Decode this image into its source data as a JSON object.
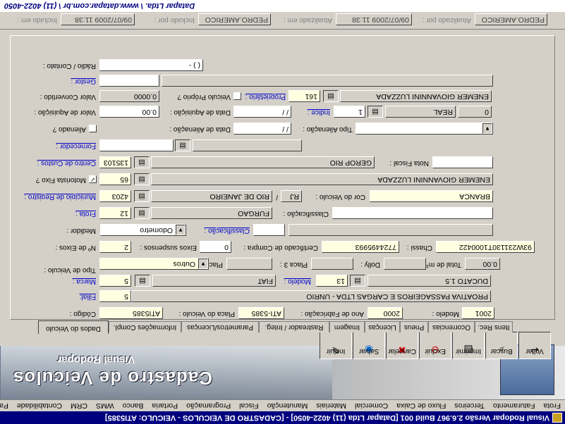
{
  "window": {
    "title": "Visual Rodopar Versão 2.6.967 Build 001 [Datapar Ltda (11) 4022-4050] - [CADASTRO DE VEICULOS - VEICULO: ATI5385]"
  },
  "menu": [
    "Frota",
    "Faturamento",
    "Terceiros",
    "Fluxo de Caixa",
    "Comercial",
    "Materiais",
    "Manutenção",
    "Fiscal",
    "Programação",
    "Portaria",
    "Banco",
    "WMS",
    "CRM",
    "Contabilidade",
    "Pa"
  ],
  "banner": {
    "title": "Cadastro de Veiculos",
    "brand": "Visual Rodopar"
  },
  "toolbar": [
    {
      "label": "Incluir",
      "icon": "✎"
    },
    {
      "label": "Salvar",
      "icon": "◉"
    },
    {
      "label": "Cancelar",
      "icon": "✖"
    },
    {
      "label": "Excluir",
      "icon": "⊖"
    },
    {
      "label": "Imprimir",
      "icon": "▤"
    },
    {
      "label": "Buscar",
      "icon": "⌕"
    },
    {
      "label": "Voltar",
      "icon": "↩"
    }
  ],
  "tabs": [
    "Dados do Veiculo",
    "Informações Compl.",
    "Parametros/Licenças",
    "Rastreador / Integ.",
    "Imagem",
    "Licenças",
    "Pneus",
    "Ocorrencias",
    "Itens Rec."
  ],
  "labels": {
    "codigo": "Código :",
    "placa": "Placa do Veiculo :",
    "ano_fab": "Ano de Fabricação :",
    "modelo_ano": "Modelo :",
    "filial": "Filial:",
    "marca": "Marca :",
    "modelo": "Modelo :",
    "tipo_veiculo": "Tipo de Veiculo :",
    "placa2": "Placa 2 :",
    "placa3": "Placa 3 :",
    "dolly": "Dolly :",
    "total_m3": "Total de m³ :",
    "nr_eixos": "Nº de Eixos :",
    "eixos_susp": "Eixos suspensos :",
    "certificado": "Certificado de Compra :",
    "chassi": "Chassi :",
    "medidor": "Medidor :",
    "classificacao": "Classificação :",
    "frota": "Frota :",
    "classificacao2": "Classificação :",
    "municipio": "Municipio de Registro :",
    "uf_sep": "/",
    "cor": "Cor do Veiculo :",
    "motorista": "Motorista Fixo ?",
    "centro_custos": "Centro de Custos :",
    "nota_fiscal": "Nota Fiscal :",
    "fornecedor": "Fornecedor :",
    "alienado": "Alienado ?",
    "data_alienacao": "Data de Alienação :",
    "tipo_alienacao": "Tipo Alienação :",
    "valor_aquisicao": "Valor de Aquisição :",
    "data_aquisicao": "Data de Aquisição :",
    "indice": "Indice :",
    "valor_convertido": "Valor Convertido :",
    "veiculo_proprio": "Veiculo Próprio ?",
    "proprietario": "Proprietário :",
    "gestor": "Gestor :",
    "radio": "Rádio / Contato :"
  },
  "values": {
    "codigo": "ATI5385",
    "placa": "ATI-5385",
    "ano_fab": "2000",
    "modelo_ano": "2001",
    "filial_code": "5",
    "filial_name": "PROATIVA PASSAGEIROS E CARGAS LTDA - UNRIO",
    "marca_code": "5",
    "marca_name": "FIAT",
    "modelo_code": "13",
    "modelo_name": "DUCATO 1.5",
    "tipo_veiculo": "Outros",
    "placa2": "",
    "placa3": "",
    "dolly": "",
    "total_m3": "0.00",
    "nr_eixos": "2",
    "eixos_susp": "0",
    "certificado": "7724495993",
    "chassi": "93W231130T1000422",
    "medidor": "Odometro",
    "classificacao": "",
    "frota": "12",
    "frota_name": "FURGAO",
    "classificacao2": "",
    "municipio_code": "4203",
    "municipio_name": "RIO DE JANEIRO",
    "uf": "RJ",
    "cor": "BRANCA",
    "motorista_code": "65",
    "motorista_name": "ENEMER GIOVANNINI LUZZADA",
    "centro_code": "135103",
    "centro_name": "GEROP RIO",
    "nota_fiscal": "",
    "fornecedor": "",
    "fornecedor_name": "",
    "data_alienacao": " / /",
    "tipo_alienacao": "",
    "valor_aquisicao": "0.00",
    "data_aquisicao": " / /",
    "indice_code": "1",
    "indice_name": "REAL",
    "indice_val": "0",
    "valor_convertido": "0.0000",
    "proprietario_code": "161",
    "proprietario_name": "ENEMER GIOVANNINI LUZZADA",
    "gestor": "",
    "gestor_name": "",
    "radio": "( )  -"
  },
  "header": {
    "incluido_em_label": "Incluido em :",
    "incluido_em": "09/07/2009 11:38",
    "incluido_por_label": "Incluido por :",
    "incluido_por": "PEDRO.AMERICO",
    "atualizado_em_label": "Atualizado em :",
    "atualizado_em": "09/07/2009 11:38",
    "atualizado_por_label": "Atualizado por :",
    "atualizado_por": "PEDRO.AMERICO",
    "links": "Datapar Ltda.  \\  www.datapar.com.br  \\  (11) 4022-4050"
  }
}
